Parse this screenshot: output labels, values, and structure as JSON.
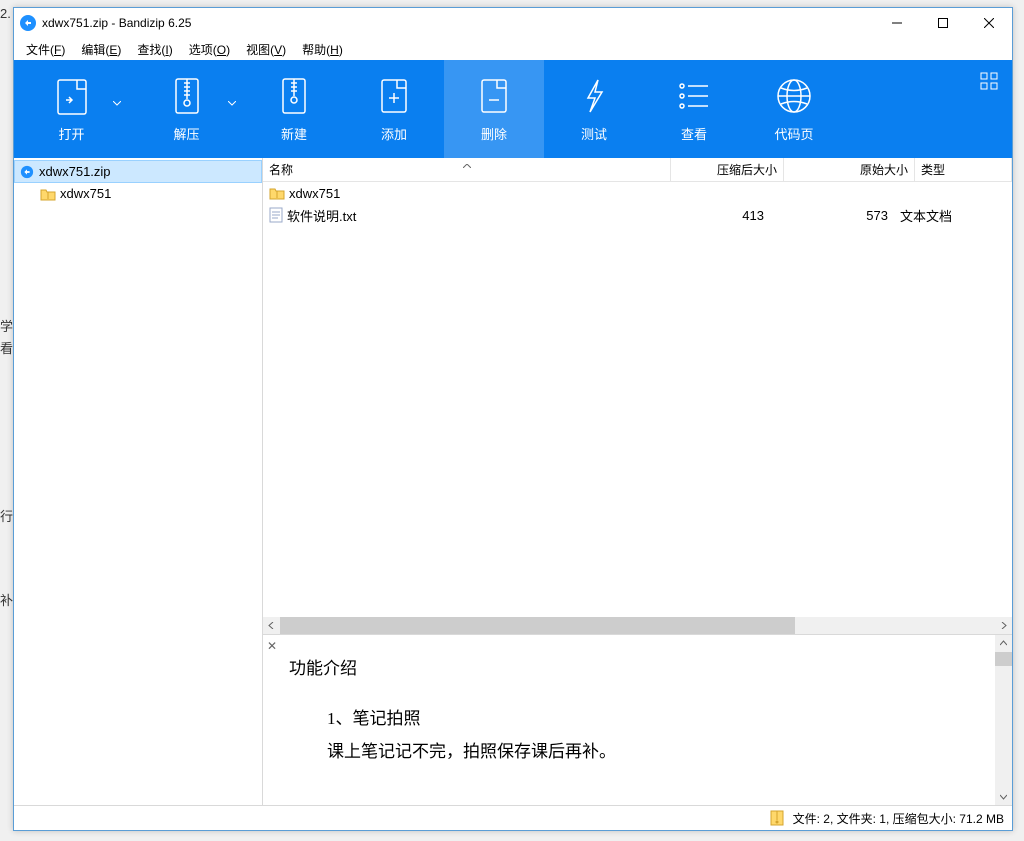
{
  "window": {
    "title": "xdwx751.zip - Bandizip 6.25"
  },
  "menubar": [
    {
      "label": "文件",
      "key": "F"
    },
    {
      "label": "编辑",
      "key": "E"
    },
    {
      "label": "查找",
      "key": "I"
    },
    {
      "label": "选项",
      "key": "O"
    },
    {
      "label": "视图",
      "key": "V"
    },
    {
      "label": "帮助",
      "key": "H"
    }
  ],
  "toolbar": {
    "open": "打开",
    "extract": "解压",
    "new": "新建",
    "add": "添加",
    "delete": "删除",
    "test": "测试",
    "view": "查看",
    "codepage": "代码页"
  },
  "tree": {
    "root": "xdwx751.zip",
    "child": "xdwx751"
  },
  "columns": {
    "name": "名称",
    "compressed": "压缩后大小",
    "original": "原始大小",
    "type": "类型"
  },
  "files": [
    {
      "name": "xdwx751",
      "compressed": "",
      "original": "",
      "type": "",
      "icon": "folder"
    },
    {
      "name": "软件说明.txt",
      "compressed": "413",
      "original": "573",
      "type": "文本文档",
      "icon": "txt"
    }
  ],
  "preview": {
    "title": "功能介绍",
    "line1": "1、笔记拍照",
    "line2": "课上笔记记不完，拍照保存课后再补。"
  },
  "statusbar": {
    "text": "文件: 2, 文件夹: 1, 压缩包大小: 71.2 MB"
  },
  "gutter": {
    "a": "2.",
    "b": "学",
    "c": "看",
    "d": "行",
    "e": "补"
  }
}
